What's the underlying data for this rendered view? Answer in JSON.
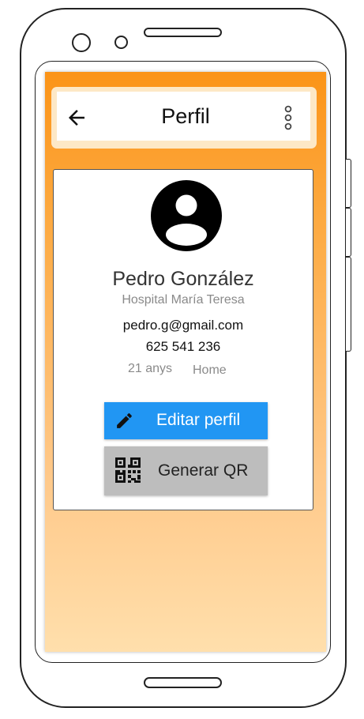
{
  "appbar": {
    "title": "Perfil",
    "back_icon": "arrow-back-icon",
    "menu_icon": "more-vertical-icon"
  },
  "profile": {
    "avatar_icon": "account-circle-icon",
    "name": "Pedro González",
    "hospital": "Hospital María Teresa",
    "email": "pedro.g@gmail.com",
    "phone": "625 541 236",
    "age": "21 anys",
    "gender": "Home"
  },
  "actions": {
    "edit_label": "Editar perfil",
    "edit_icon": "pencil-icon",
    "qr_label": "Generar QR",
    "qr_icon": "qr-code-icon"
  },
  "colors": {
    "header_orange": "#fb9418",
    "background_bottom": "#ffdfac",
    "edit_button": "#2196f3",
    "qr_button": "#bdbdbd"
  }
}
